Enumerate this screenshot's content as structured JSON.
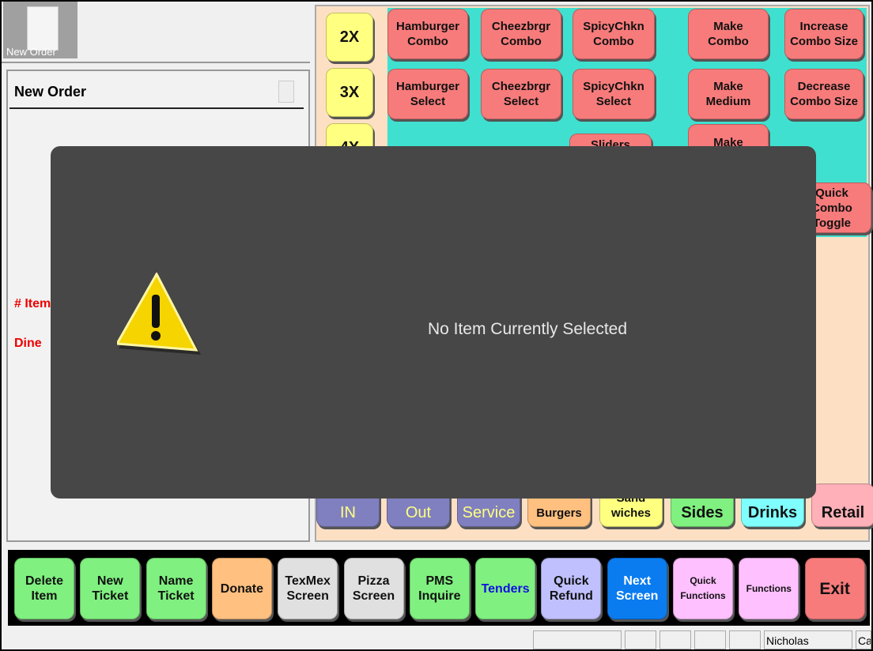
{
  "top_tab": {
    "label": "New Order"
  },
  "order_panel": {
    "title": "New Order",
    "items_label": "# Item",
    "dine_label": "Dine"
  },
  "multipliers": [
    "2X",
    "3X",
    "4X"
  ],
  "menu_buttons": {
    "row1": [
      "Hamburger\nCombo",
      "Cheezbrgr\nCombo",
      "SpicyChkn\nCombo",
      "Make\nCombo",
      "Increase\nCombo Size"
    ],
    "row2": [
      "Hamburger\nSelect",
      "Cheezbrgr\nSelect",
      "SpicyChkn\nSelect",
      "Make\nMedium",
      "Decrease\nCombo Size"
    ],
    "row3": [
      "Sliders",
      "Make",
      "Quick\nCombo\nToggle"
    ]
  },
  "category_tabs": [
    "IN",
    "Out",
    "Service",
    "Burgers",
    "Sand\nwiches",
    "Sides",
    "Drinks",
    "Retail"
  ],
  "function_bar": [
    "Delete\nItem",
    "New\nTicket",
    "Name\nTicket",
    "Donate",
    "TexMex\nScreen",
    "Pizza\nScreen",
    "PMS\nInquire",
    "Tenders",
    "Quick\nRefund",
    "Next\nScreen",
    "Quick\nFunctions",
    "Functions",
    "Exit"
  ],
  "status_bar": {
    "user": "Nicholas",
    "extra": "Ca"
  },
  "dialog": {
    "message": "No Item Currently Selected",
    "icon": "warning-icon"
  },
  "colors": {
    "menu_bg": "#40e0d0",
    "dialog_bg": "#474747",
    "accent_blue": "#0a7cf0"
  }
}
